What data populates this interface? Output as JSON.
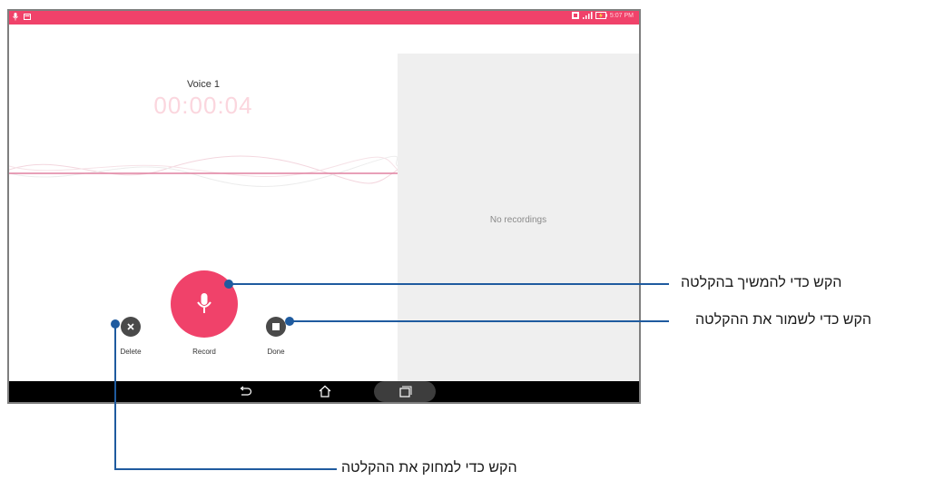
{
  "status_bar": {
    "left_icons": [
      "mic-icon",
      "message-icon"
    ],
    "right_icons": [
      "data-4g-icon",
      "signal-icon",
      "battery-charging-icon"
    ],
    "time": "5:07 PM"
  },
  "recorder": {
    "title": "Voice 1",
    "timer": "00:00:04"
  },
  "recordings_panel": {
    "empty_text": "No recordings"
  },
  "controls": {
    "delete_label": "Delete",
    "record_label": "Record",
    "done_label": "Done"
  },
  "nav_bar": {
    "icons": [
      "back-icon",
      "home-icon",
      "recent-apps-icon"
    ]
  },
  "callouts": {
    "record": "הקש כדי להמשיך בהקלטה",
    "done": "הקש כדי לשמור את ההקלטה",
    "delete": "הקש כדי למחוק את ההקלטה"
  },
  "colors": {
    "accent": "#f0426a",
    "callout_line": "#1f5b9f",
    "control_dark": "#4a4a4a"
  }
}
